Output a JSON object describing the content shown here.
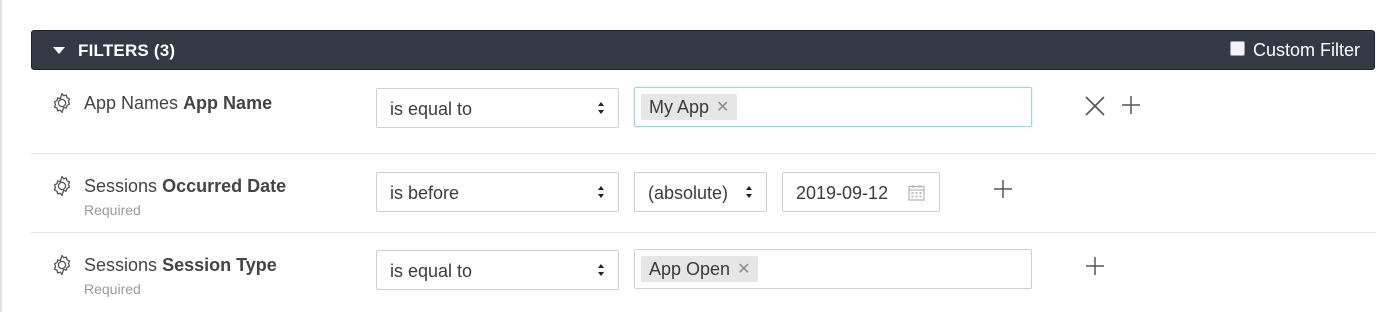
{
  "filters": {
    "header": {
      "title": "FILTERS (3)",
      "custom_filter_label": "Custom Filter",
      "custom_filter_checked": false
    },
    "rows": [
      {
        "category": "App Names",
        "field": "App Name",
        "note": "",
        "operator": "is equal to",
        "tags": [
          "My App"
        ],
        "remove_icon": "close-icon",
        "add_icon": "plus-icon"
      },
      {
        "category": "Sessions",
        "field": "Occurred Date",
        "note": "Required",
        "operator": "is before",
        "mode": "(absolute)",
        "date": "2019-09-12",
        "add_icon": "plus-icon"
      },
      {
        "category": "Sessions",
        "field": "Session Type",
        "note": "Required",
        "operator": "is equal to",
        "tags": [
          "App Open"
        ],
        "add_icon": "plus-icon"
      }
    ],
    "colors": {
      "header_bg": "#333a45",
      "focus_border": "#9fd5df",
      "tag_bg": "#e6e6e6"
    }
  }
}
